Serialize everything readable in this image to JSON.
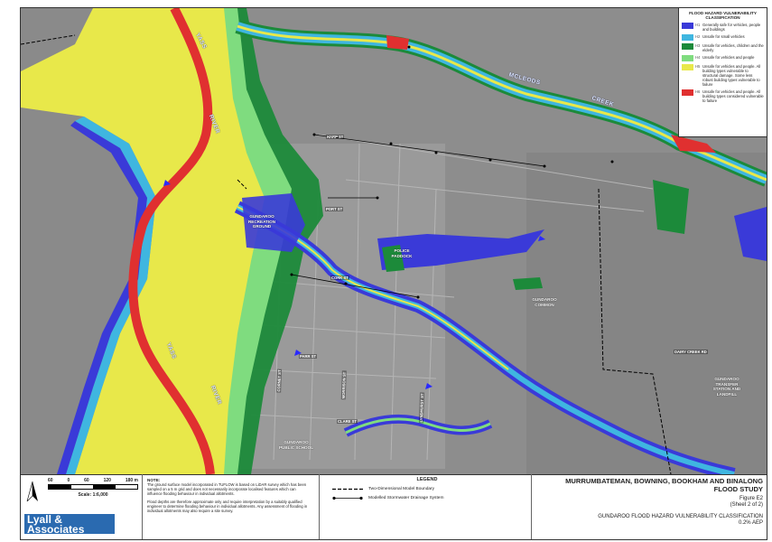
{
  "legend": {
    "title": "FLOOD HAZARD VULNERABILITY CLASSIFICATION",
    "items": [
      {
        "code": "H1",
        "color": "#3a3ad8",
        "text": "Generally safe for vehicles, people and buildings"
      },
      {
        "code": "H2",
        "color": "#3fb6e0",
        "text": "Unsafe for small vehicles"
      },
      {
        "code": "H3",
        "color": "#1c8a3a",
        "text": "Unsafe for vehicles, children and the elderly"
      },
      {
        "code": "H4",
        "color": "#7fdc7f",
        "text": "Unsafe for vehicles and people"
      },
      {
        "code": "H5",
        "color": "#e8e84a",
        "text": "Unsafe for vehicles and people. All building types vulnerable to structural damage. Some less robust building types vulnerable to failure"
      },
      {
        "code": "H6",
        "color": "#e03030",
        "text": "Unsafe for vehicles and people. All building types considered vulnerable to failure"
      }
    ]
  },
  "map_labels": {
    "yass_river_1": "YASS",
    "yass_river_2": "RIVER",
    "yass_river_3": "YASS",
    "yass_river_4": "RIVER",
    "yass_top": "YASS",
    "mcleods": "MCLEODS",
    "creek": "CREEK",
    "recreation_ground": "GUNDAROO RECREATION GROUND",
    "police_paddock": "POLICE PADDOCK",
    "common": "GUNDAROO COMMON",
    "transfer_station": "GUNDAROO TRANSFER STATION AND LANDFILL",
    "public_school": "GUNDAROO PUBLIC SCHOOL",
    "cork_st": "CORK ST",
    "parr_st": "PARR ST",
    "dairy_creek_rd": "DAIRY CREEK RD",
    "street_west": "CORNET ST",
    "street_mid": "MORRISON ST",
    "street_east": "LYNDHURST ST",
    "street_north": "HARP ST",
    "street_ne": "PORT ST",
    "street_n2": "CORK ST",
    "street_south": "CLARE ST",
    "street_sa": "LONGFORD ST",
    "street_far": "CORNWALL ST"
  },
  "scale": {
    "ticks": [
      "60",
      "0",
      "60",
      "120",
      "180 m"
    ],
    "text": "Scale: 1:6,000"
  },
  "logo": {
    "line1": "Lyall &",
    "line2": "Associates"
  },
  "notes": {
    "heading": "NOTE:",
    "p1": "The ground surface model incorporated in TUFLOW is based on LiDAR survey which has been sampled on a 5 m grid and does not necessarily incorporate localised features which can influence flooding behaviour in individual allotments.",
    "p2": "Flood depths are therefore approximate only and require interpretation by a suitably qualified engineer to determine flooding behaviour in individual allotments. Any assessment of flooding in individual allotments may also require a site survey."
  },
  "legend2": {
    "title": "LEGEND",
    "boundary": "Two-Dimensional Model Boundary",
    "drainage": "Modelled Stormwater Drainage System"
  },
  "title_block": {
    "line1": "MURRUMBATEMAN, BOWNING, BOOKHAM AND BINALONG",
    "line2": "FLOOD STUDY",
    "figure": "Figure E2",
    "sheet": "(Sheet 2 of 2)",
    "subtitle": "GUNDAROO FLOOD HAZARD VULNERABILITY CLASSIFICATION",
    "aep": "0.2% AEP"
  },
  "colors": {
    "h1": "#3a3ad8",
    "h2": "#3fb6e0",
    "h3": "#1c8a3a",
    "h4": "#7fdc7f",
    "h5": "#e8e84a",
    "h6": "#e03030",
    "aerial": "#8f8f8f",
    "logo": "#2a6ab0"
  }
}
